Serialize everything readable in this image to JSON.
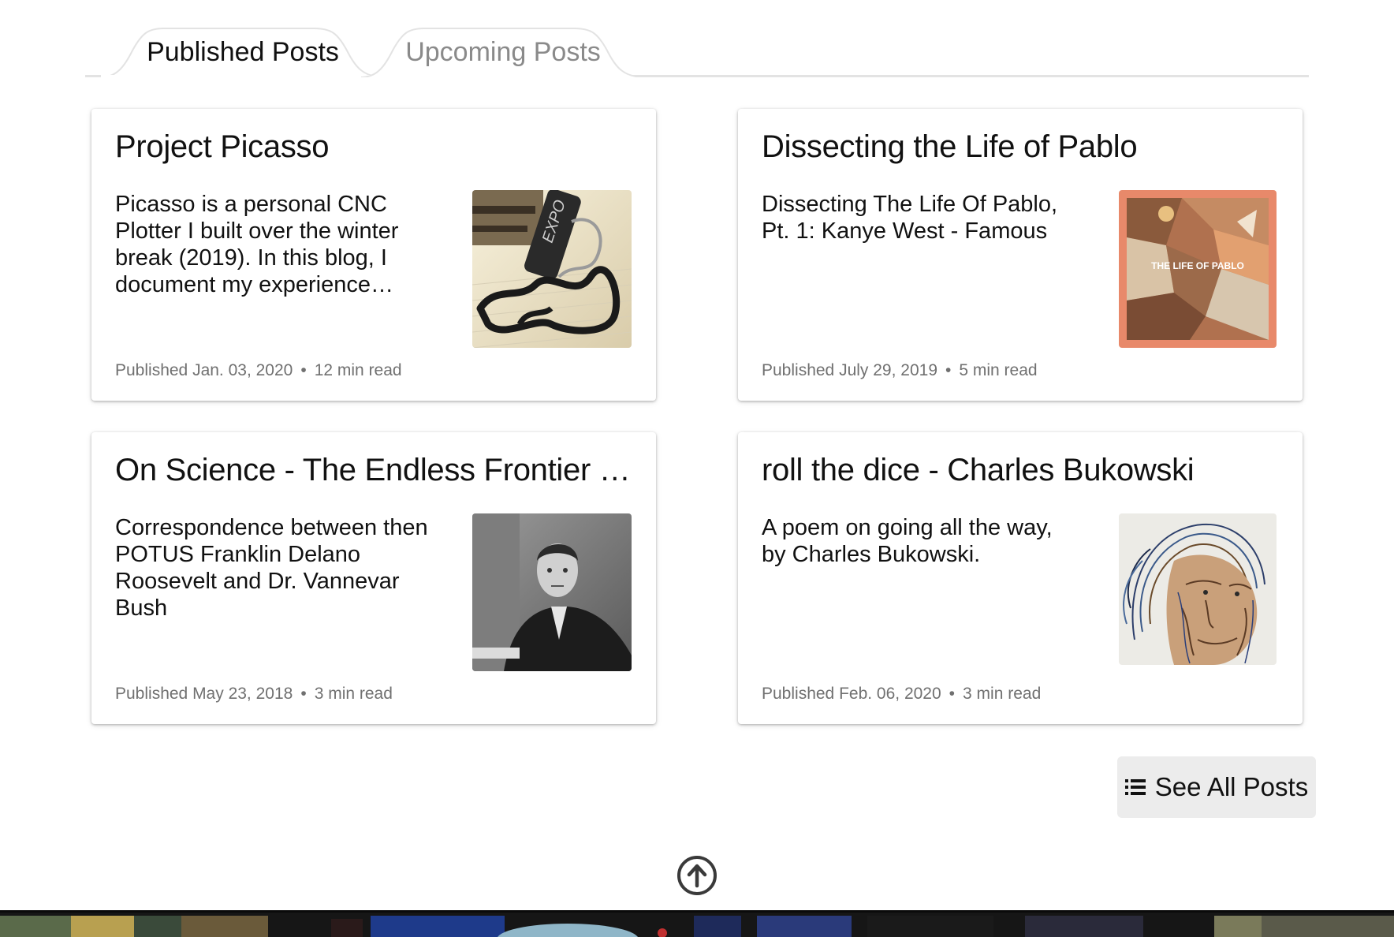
{
  "tabs": {
    "published_label": "Published Posts",
    "upcoming_label": "Upcoming Posts"
  },
  "posts": [
    {
      "title": "Project Picasso",
      "excerpt": "Picasso is a personal CNC Plotter I built over the winter break (2019). In this blog, I document my experience…",
      "published": "Published Jan. 03, 2020",
      "read_time": "12 min read",
      "thumbnail": "cnc-plotter-marker-drawing"
    },
    {
      "title": "Dissecting the Life of Pablo",
      "excerpt": "Dissecting The Life Of Pablo, Pt. 1: Kanye West - Famous",
      "published": "Published July 29, 2019",
      "read_time": "5 min read",
      "thumbnail": "life-of-pablo-album-cover",
      "thumbnail_caption": "THE LIFE OF PABLO"
    },
    {
      "title": "On Science - The Endless Frontier | Pa…",
      "excerpt": "Correspondence between then POTUS Franklin Delano Roosevelt and Dr. Vannevar Bush",
      "published": "Published May 23, 2018",
      "read_time": "3 min read",
      "thumbnail": "fdr-black-and-white-portrait"
    },
    {
      "title": "roll the dice - Charles Bukowski",
      "excerpt": "A poem on going all the way, by Charles Bukowski.",
      "published": "Published Feb. 06, 2020",
      "read_time": "3 min read",
      "thumbnail": "bukowski-sketch-portrait"
    }
  ],
  "meta_separator": "•",
  "see_all": {
    "label": "See All Posts",
    "icon": "list-icon"
  },
  "back_to_top": {
    "icon": "arrow-up-circle-icon"
  },
  "colors": {
    "tab_inactive": "#8a8a8a",
    "meta_text": "#707070",
    "button_bg": "#ececec",
    "pablo_orange": "#e8896a"
  }
}
